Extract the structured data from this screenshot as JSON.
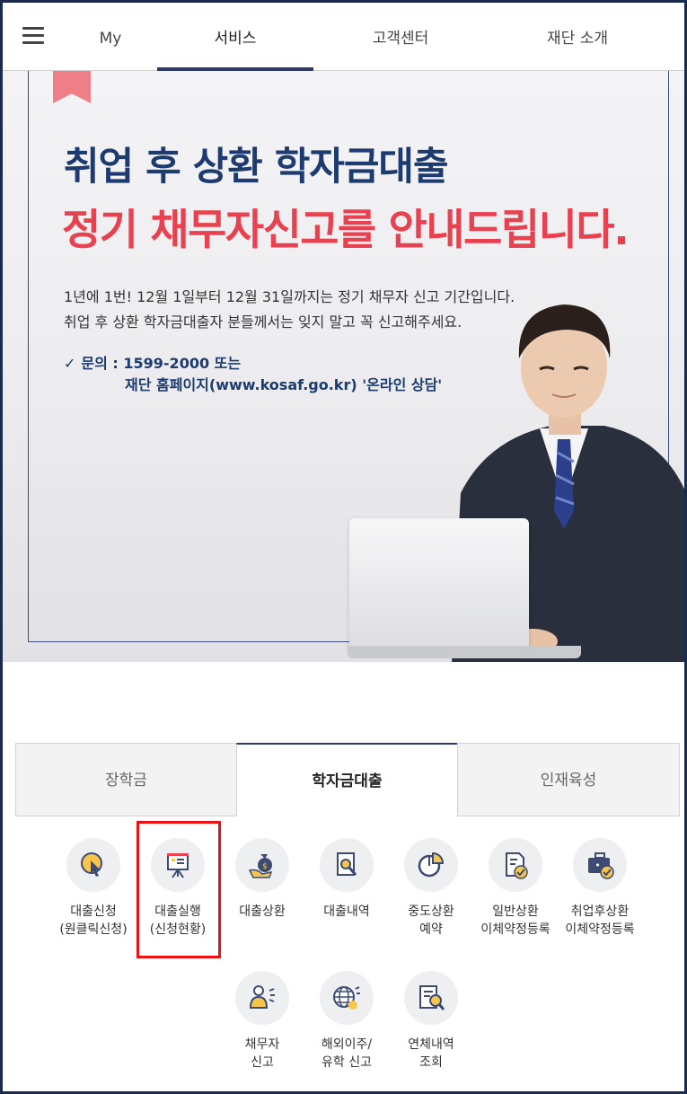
{
  "topnav": {
    "menu_icon": "hamburger-menu-icon",
    "items": [
      {
        "label": "My",
        "active": false
      },
      {
        "label": "서비스",
        "active": true
      },
      {
        "label": "고객센터",
        "active": false
      },
      {
        "label": "재단 소개",
        "active": false
      }
    ]
  },
  "banner": {
    "headline_line1": "취업 후 상환 학자금대출",
    "headline_line2": "정기 채무자신고를 안내드립니다.",
    "body_line1": "1년에 1번! 12월 1일부터 12월 31일까지는 정기 채무자 신고 기간입니다.",
    "body_line2": "취업 후 상환 학자금대출자 분들께서는 잊지 말고 꼭 신고해주세요.",
    "contact_check": "✓",
    "contact_line1": "문의 : 1599-2000 또는",
    "contact_line2": "재단 홈페이지(www.kosaf.go.kr) '온라인 상담'",
    "colors": {
      "navy": "#1d3b6f",
      "red": "#e8414f",
      "bookmark": "#ef7f86"
    }
  },
  "tabs": [
    {
      "label": "장학금",
      "active": false
    },
    {
      "label": "학자금대출",
      "active": true
    },
    {
      "label": "인재육성",
      "active": false
    }
  ],
  "services_row1": [
    {
      "line1": "대출신청",
      "line2": "(원클릭신청)",
      "icon": "cursor-click-icon",
      "highlighted": false
    },
    {
      "line1": "대출실행",
      "line2": "(신청현황)",
      "icon": "presentation-board-icon",
      "highlighted": true
    },
    {
      "line1": "대출상환",
      "line2": "",
      "icon": "money-bag-hand-icon",
      "highlighted": false
    },
    {
      "line1": "대출내역",
      "line2": "",
      "icon": "document-search-icon",
      "highlighted": false
    },
    {
      "line1": "중도상환",
      "line2": "예약",
      "icon": "pie-chart-icon",
      "highlighted": false
    },
    {
      "line1": "일반상환",
      "line2": "이체약정등록",
      "icon": "document-check-icon",
      "highlighted": false
    },
    {
      "line1": "취업후상환",
      "line2": "이체약정등록",
      "icon": "briefcase-check-icon",
      "highlighted": false
    }
  ],
  "services_row2": [
    {
      "line1": "채무자",
      "line2": "신고",
      "icon": "person-alert-icon"
    },
    {
      "line1": "해외이주/",
      "line2": "유학 신고",
      "icon": "globe-alert-icon"
    },
    {
      "line1": "연체내역",
      "line2": "조회",
      "icon": "document-magnifier-icon"
    }
  ],
  "highlight_color": "#e11111"
}
